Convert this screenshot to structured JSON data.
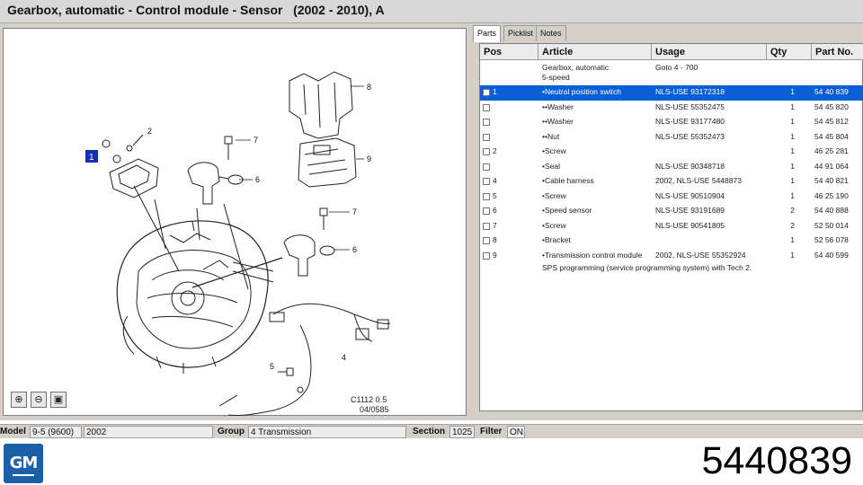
{
  "window": {
    "title": "Gearbox, automatic - Control module - Sensor   (2002 - 2010), A"
  },
  "diagram": {
    "callouts": [
      "1",
      "2",
      "7",
      "6",
      "8",
      "9",
      "7",
      "6",
      "5",
      "4"
    ],
    "drawing_code": "C1112 0.5",
    "drawing_date": "04/0585",
    "zoom_in_icon": "zoom-in-icon",
    "zoom_out_icon": "zoom-out-icon",
    "fit_icon": "fit-view-icon"
  },
  "tabs": [
    {
      "label": "Parts",
      "active": true
    },
    {
      "label": "Picklist",
      "active": false
    },
    {
      "label": "Notes",
      "active": false
    }
  ],
  "table": {
    "headers": [
      "Pos",
      "Article",
      "Usage",
      "Qty",
      "Part No."
    ],
    "group_header": {
      "article_line1": "Gearbox, automatic",
      "article_line2": "5-speed",
      "usage": "Goto 4 - 700"
    },
    "rows": [
      {
        "pos": "1",
        "article": "•Neutral position switch",
        "usage": "NLS-USE 93172318",
        "qty": "1",
        "part": "54 40 839",
        "selected": true
      },
      {
        "pos": "",
        "article": "••Washer",
        "usage": "NLS-USE 55352475",
        "qty": "1",
        "part": "54 45 820"
      },
      {
        "pos": "",
        "article": "••Washer",
        "usage": "NLS-USE 93177480",
        "qty": "1",
        "part": "54 45 812"
      },
      {
        "pos": "",
        "article": "••Nut",
        "usage": "NLS-USE 55352473",
        "qty": "1",
        "part": "54 45 804"
      },
      {
        "pos": "2",
        "article": "•Screw",
        "usage": "",
        "qty": "1",
        "part": "46 25 281"
      },
      {
        "pos": "",
        "article": "•Seal",
        "usage": "NLS-USE 90348718",
        "qty": "1",
        "part": "44 91 064"
      },
      {
        "pos": "4",
        "article": "•Cable harness",
        "usage": "2002, NLS-USE 5448873",
        "qty": "1",
        "part": "54 40 821"
      },
      {
        "pos": "5",
        "article": "•Screw",
        "usage": "NLS-USE 90510904",
        "qty": "1",
        "part": "46 25 190"
      },
      {
        "pos": "6",
        "article": "•Speed sensor",
        "usage": "NLS-USE 93191689",
        "qty": "2",
        "part": "54 40 888"
      },
      {
        "pos": "7",
        "article": "•Screw",
        "usage": "NLS-USE 90541805",
        "qty": "2",
        "part": "52 50 014"
      },
      {
        "pos": "8",
        "article": "•Bracket",
        "usage": "",
        "qty": "1",
        "part": "52 56 078"
      },
      {
        "pos": "9",
        "article": "•Transmission control module",
        "usage": "2002, NLS-USE 55352924",
        "qty": "1",
        "part": "54 40 599"
      }
    ],
    "footnote": "SPS programming (service programming system) with Tech 2."
  },
  "statusbar": {
    "model_label": "Model",
    "model_value": "9-5 (9600)",
    "year_value": "2002",
    "group_label": "Group",
    "group_value": "4 Transmission",
    "section_label": "Section",
    "section_value": "1025",
    "filter_label": "Filter",
    "filter_value": "ON"
  },
  "footer": {
    "logo_text": "GM",
    "part_number": "5440839"
  },
  "colors": {
    "selection": "#0a5fd6",
    "brand": "#1b5fa8"
  }
}
